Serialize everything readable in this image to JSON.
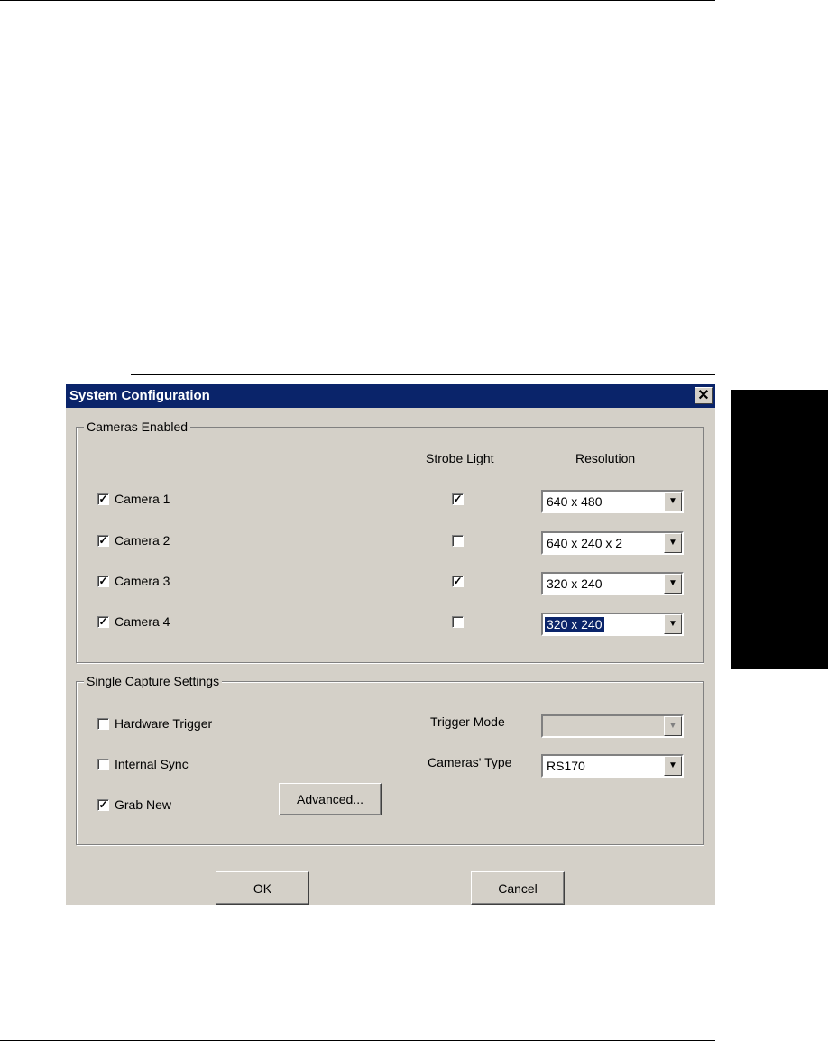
{
  "dialog": {
    "title": "System Configuration",
    "close_label": "✕"
  },
  "cameras_enabled": {
    "group_label": "Cameras Enabled",
    "strobe_header": "Strobe Light",
    "resolution_header": "Resolution",
    "cameras": [
      {
        "label": "Camera 1",
        "enabled": true,
        "strobe": true,
        "resolution": "640 x 480"
      },
      {
        "label": "Camera 2",
        "enabled": true,
        "strobe": false,
        "resolution": "640 x 240 x 2"
      },
      {
        "label": "Camera 3",
        "enabled": true,
        "strobe": true,
        "resolution": "320 x 240"
      },
      {
        "label": "Camera 4",
        "enabled": true,
        "strobe": false,
        "resolution": "320 x 240"
      }
    ]
  },
  "single_capture": {
    "group_label": "Single Capture Settings",
    "hardware_trigger": {
      "label": "Hardware Trigger",
      "checked": false
    },
    "internal_sync": {
      "label": "Internal Sync",
      "checked": false
    },
    "grab_new": {
      "label": "Grab New",
      "checked": true
    },
    "advanced_label": "Advanced...",
    "trigger_mode_label": "Trigger Mode",
    "trigger_mode_value": "",
    "cameras_type_label": "Cameras' Type",
    "cameras_type_value": "RS170"
  },
  "buttons": {
    "ok_label": "OK",
    "cancel_label": "Cancel"
  },
  "colors": {
    "title_bar": "#0a246a",
    "dialog_face": "#d4d0c8"
  }
}
